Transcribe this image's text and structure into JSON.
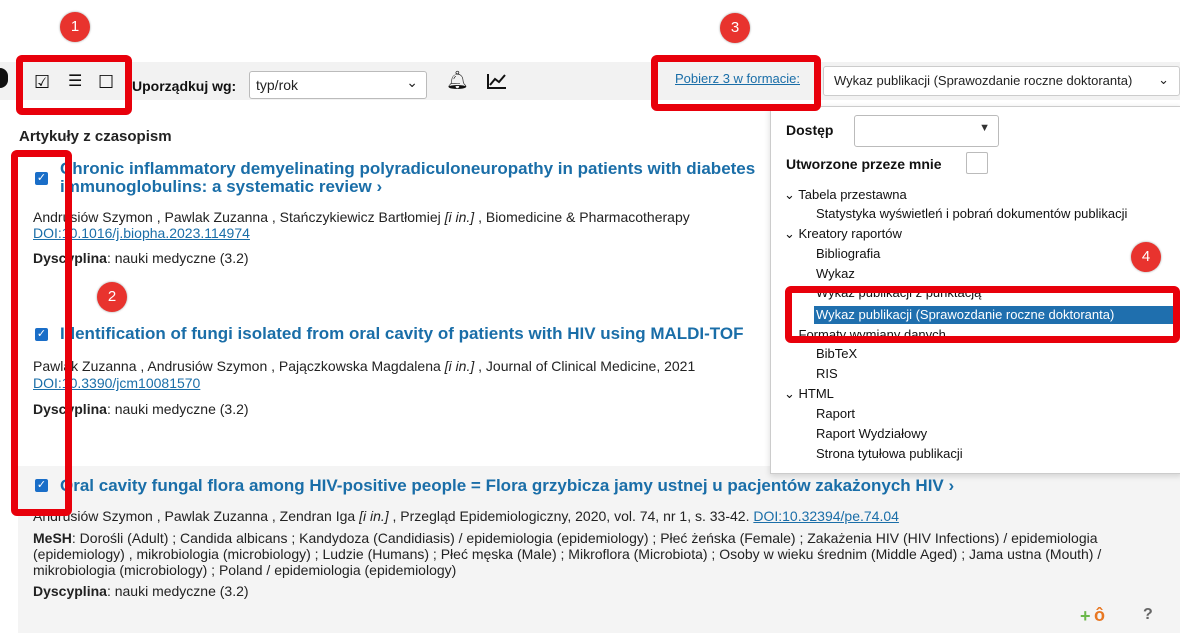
{
  "toolbar": {
    "sort_label": "Uporządkuj wg:",
    "sort_value": "typ/rok",
    "download_link": "Pobierz 3 w formacie:",
    "format_value": "Wykaz publikacji (Sprawozdanie roczne doktoranta)"
  },
  "section_title": "Artykuły z czasopism",
  "articles": [
    {
      "title_l1": "Chronic inflammatory demyelinating polyradiculoneuropathy in patients with diabetes",
      "title_l2": "immunoglobulins: a systematic review  ›",
      "authors": "Andrusiów Szymon , Pawlak Zuzanna , Stańczykiewicz Bartłomiej ",
      "in": "[i in.]",
      "source": " , Biomedicine & Pharmacotherapy",
      "doi": "DOI:10.1016/j.biopha.2023.114974",
      "disc_label": "Dyscyplina",
      "disc_value": ": nauki medyczne (3.2)"
    },
    {
      "title_l1": "Identification of fungi isolated from oral cavity of patients with HIV using MALDI-TOF",
      "authors": "Pawlak Zuzanna , Andrusiów Szymon , Pajączkowska Magdalena ",
      "in": "[i in.]",
      "source": " , Journal of Clinical Medicine, 2021",
      "doi": "DOI:10.3390/jcm10081570",
      "disc_label": "Dyscyplina",
      "disc_value": ": nauki medyczne (3.2)"
    },
    {
      "title_l1": "Oral cavity fungal flora among HIV-positive people = Flora grzybicza jamy ustnej u pacjentów zakażonych HIV  ›",
      "authors": "Andrusiów Szymon , Pawlak Zuzanna , Zendran Iga ",
      "in": "[i in.]",
      "source": " , Przegląd Epidemiologiczny, 2020, vol. 74, nr 1, s. 33-42. ",
      "doi": "DOI:10.32394/pe.74.04",
      "mesh_label": "MeSH",
      "mesh_text": ": Dorośli (Adult) ; Candida albicans ; Kandydoza (Candidiasis) / epidemiologia (epidemiology) ; Płeć żeńska (Female) ; Zakażenia HIV (HIV Infections) / epidemiologia (epidemiology) , mikrobiologia (microbiology) ; Ludzie (Humans) ; Płeć męska (Male) ; Mikroflora (Microbiota) ; Osoby w wieku średnim (Middle Aged) ; Jama ustna (Mouth) / mikrobiologia (microbiology) ; Poland / epidemiologia (epidemiology)",
      "disc_label": "Dyscyplina",
      "disc_value": ": nauki medyczne (3.2)"
    }
  ],
  "dropdown": {
    "access_label": "Dostęp",
    "created_label": "Utworzone przeze mnie",
    "groups": [
      {
        "label": "Tabela przestawna",
        "items": [
          "Statystyka wyświetleń i pobrań dokumentów publikacji"
        ]
      },
      {
        "label": "Kreatory raportów",
        "items": [
          "Bibliografia",
          "Wykaz",
          "Wykaz publikacji z punktacją",
          "Wykaz publikacji (Sprawozdanie roczne doktoranta)"
        ]
      },
      {
        "label": "Formaty wymiany danych",
        "items": [
          "BibTeX",
          "RIS"
        ]
      },
      {
        "label": "HTML",
        "items": [
          "Raport",
          "Raport Wydziałowy",
          "Strona tytułowa publikacji"
        ]
      }
    ]
  },
  "badges": [
    "1",
    "2",
    "3",
    "4"
  ],
  "footer_help": "?",
  "colors": {
    "accent": "#1a6ea8",
    "annotation_red": "#e8000b",
    "selected": "#1f6fae"
  }
}
